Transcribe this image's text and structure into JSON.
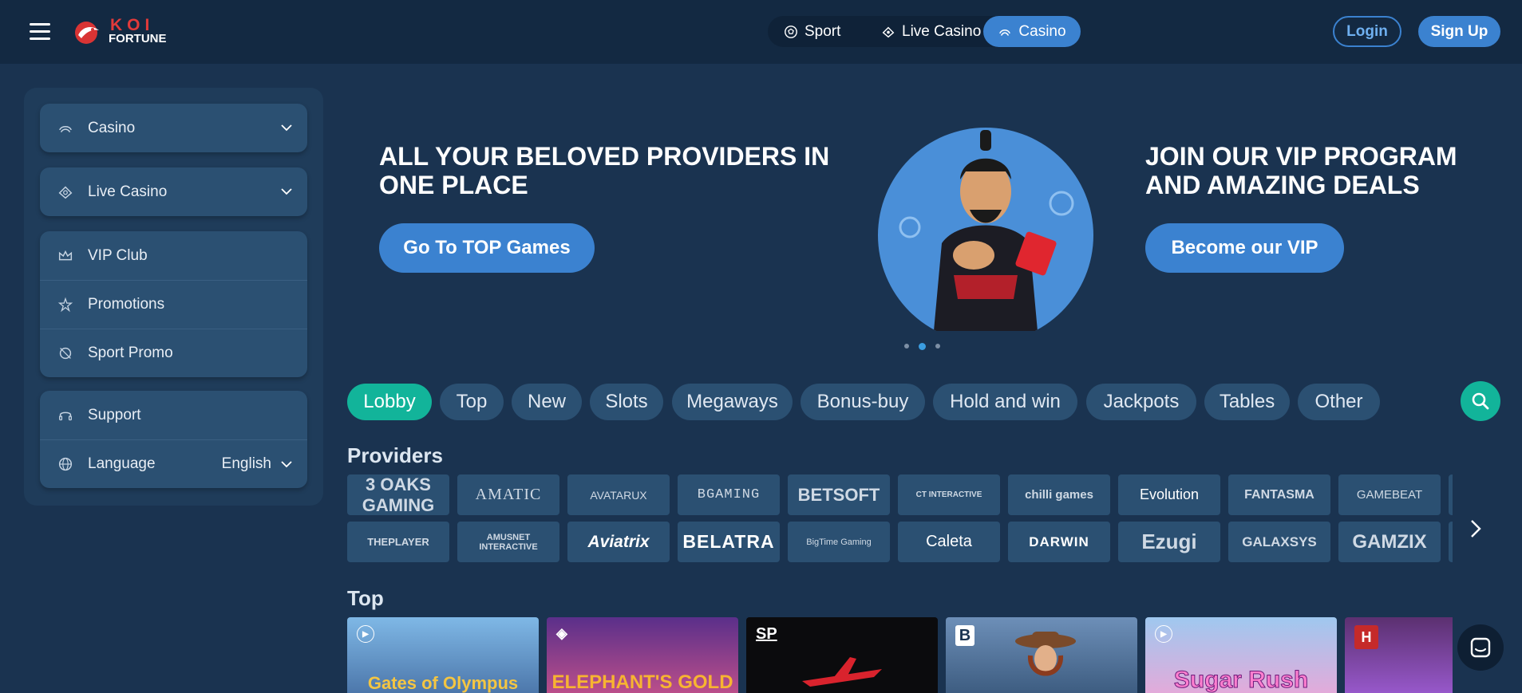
{
  "header": {
    "logo_top": "KOI",
    "logo_bottom": "FORTUNE",
    "nav": [
      {
        "label": "Sport",
        "icon": "soccer-ball-icon"
      },
      {
        "label": "Live Casino",
        "icon": "live-casino-icon"
      },
      {
        "label": "Casino",
        "icon": "casino-icon",
        "active": true
      }
    ],
    "login_label": "Login",
    "signup_label": "Sign Up"
  },
  "sidebar": {
    "groups": [
      [
        {
          "label": "Casino",
          "icon": "casino-icon",
          "expandable": true
        }
      ],
      [
        {
          "label": "Live Casino",
          "icon": "live-casino-icon",
          "expandable": true
        }
      ],
      [
        {
          "label": "VIP Club",
          "icon": "crown-icon"
        },
        {
          "label": "Promotions",
          "icon": "stars-icon"
        },
        {
          "label": "Sport Promo",
          "icon": "sport-promo-icon"
        }
      ],
      [
        {
          "label": "Support",
          "icon": "headset-icon"
        },
        {
          "label": "Language",
          "icon": "globe-icon",
          "value": "English"
        }
      ]
    ]
  },
  "banner": {
    "left_title": "ALL YOUR BELOVED PROVIDERS IN ONE PLACE",
    "left_button": "Go To TOP Games",
    "right_title": "JOIN OUR VIP PROGRAM AND AMAZING DEALS",
    "right_button": "Become our VIP",
    "slides": 3,
    "active_slide": 2
  },
  "categories": [
    "Lobby",
    "Top",
    "New",
    "Slots",
    "Megaways",
    "Bonus-buy",
    "Hold and win",
    "Jackpots",
    "Tables",
    "Other"
  ],
  "active_category": "Lobby",
  "providers_title": "Providers",
  "providers_row1": [
    "3 OAKS GAMING",
    "AMATIC",
    "AVATARUX",
    "BGAMING",
    "BETSOFT",
    "CT INTERACTIVE",
    "chilli games",
    "Evolution",
    "FANTASMA",
    "GAMEBEAT"
  ],
  "providers_row2": [
    "THEPLAYER",
    "AMUSNET INTERACTIVE",
    "Aviatrix",
    "BELATRA",
    "BigTime Gaming",
    "Caleta",
    "DARWIN",
    "Ezugi",
    "GALAXSYS",
    "GAMZIX"
  ],
  "top_title": "Top",
  "top_games": [
    "Gates of Olympus",
    "ELEPHANT'S GOLD",
    "SP",
    "B",
    "Sugar Rush",
    "H"
  ],
  "colors": {
    "accent": "#3b82d0",
    "teal": "#12b49a",
    "bg": "#1a3350",
    "header": "#132942"
  }
}
